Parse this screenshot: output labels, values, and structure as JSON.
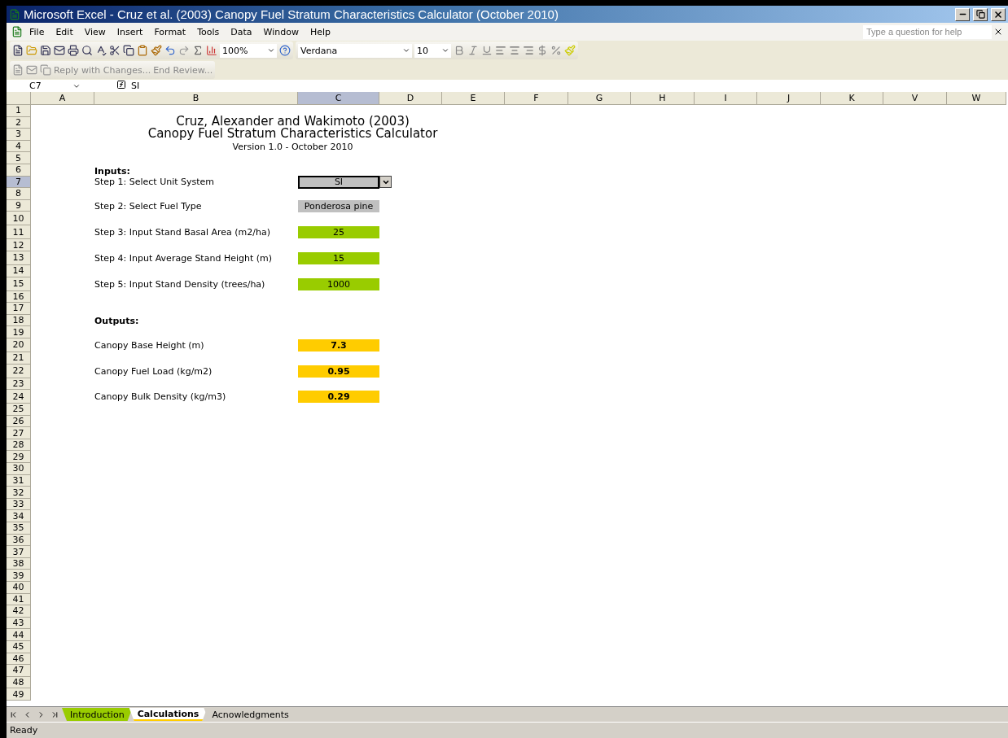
{
  "window": {
    "title": "Microsoft Excel - Cruz et al. (2003) Canopy Fuel Stratum Characteristics Calculator (October 2010)"
  },
  "menu": [
    "File",
    "Edit",
    "View",
    "Insert",
    "Format",
    "Tools",
    "Data",
    "Window",
    "Help"
  ],
  "help_box": {
    "placeholder": "Type a question for help"
  },
  "toolbar": {
    "zoom": "100%",
    "font": "Verdana",
    "font_size": "10"
  },
  "review_toolbar": [
    "Reply with Changes...",
    "End Review..."
  ],
  "formula_bar": {
    "name_box": "C7",
    "formula": "SI"
  },
  "columns": [
    {
      "label": "A",
      "selected": false
    },
    {
      "label": "B",
      "selected": false
    },
    {
      "label": "C",
      "selected": true
    },
    {
      "label": "D",
      "selected": false
    },
    {
      "label": "E",
      "selected": false
    },
    {
      "label": "F",
      "selected": false
    },
    {
      "label": "G",
      "selected": false
    },
    {
      "label": "H",
      "selected": false
    },
    {
      "label": "I",
      "selected": false
    },
    {
      "label": "J",
      "selected": false
    },
    {
      "label": "K",
      "selected": false
    },
    {
      "label": "V",
      "selected": false
    },
    {
      "label": "W",
      "selected": false
    }
  ],
  "rows": [
    {
      "label": "1",
      "selected": false
    },
    {
      "label": "2",
      "selected": false
    },
    {
      "label": "3",
      "selected": false
    },
    {
      "label": "4",
      "selected": false
    },
    {
      "label": "5",
      "selected": false
    },
    {
      "label": "6",
      "selected": false
    },
    {
      "label": "7",
      "selected": true
    },
    {
      "label": "8",
      "selected": false
    },
    {
      "label": "9",
      "selected": false
    },
    {
      "label": "10",
      "selected": false
    },
    {
      "label": "11",
      "selected": false
    },
    {
      "label": "12",
      "selected": false
    },
    {
      "label": "13",
      "selected": false
    },
    {
      "label": "14",
      "selected": false
    },
    {
      "label": "15",
      "selected": false
    },
    {
      "label": "16",
      "selected": false
    },
    {
      "label": "17",
      "selected": false
    },
    {
      "label": "18",
      "selected": false
    },
    {
      "label": "19",
      "selected": false
    },
    {
      "label": "20",
      "selected": false
    },
    {
      "label": "21",
      "selected": false
    },
    {
      "label": "22",
      "selected": false
    },
    {
      "label": "23",
      "selected": false
    },
    {
      "label": "24",
      "selected": false
    },
    {
      "label": "25",
      "selected": false
    },
    {
      "label": "26",
      "selected": false
    },
    {
      "label": "27",
      "selected": false
    },
    {
      "label": "28",
      "selected": false
    },
    {
      "label": "29",
      "selected": false
    },
    {
      "label": "30",
      "selected": false
    },
    {
      "label": "31",
      "selected": false
    },
    {
      "label": "32",
      "selected": false
    },
    {
      "label": "33",
      "selected": false
    },
    {
      "label": "34",
      "selected": false
    },
    {
      "label": "35",
      "selected": false
    },
    {
      "label": "36",
      "selected": false
    },
    {
      "label": "37",
      "selected": false
    },
    {
      "label": "38",
      "selected": false
    },
    {
      "label": "39",
      "selected": false
    },
    {
      "label": "40",
      "selected": false
    },
    {
      "label": "41",
      "selected": false
    },
    {
      "label": "42",
      "selected": false
    },
    {
      "label": "43",
      "selected": false
    },
    {
      "label": "44",
      "selected": false
    },
    {
      "label": "45",
      "selected": false
    },
    {
      "label": "46",
      "selected": false
    },
    {
      "label": "47",
      "selected": false
    },
    {
      "label": "48",
      "selected": false
    },
    {
      "label": "49",
      "selected": false
    }
  ],
  "sheet": {
    "title_lines": [
      "Cruz, Alexander and Wakimoto (2003)",
      "Canopy Fuel Stratum Characteristics Calculator",
      "Version 1.0 - October 2010"
    ],
    "inputs_heading": "Inputs:",
    "inputs": [
      {
        "label": "Step 1: Select Unit System",
        "value": "SI",
        "kind": "dropdown"
      },
      {
        "label": "Step 2: Select Fuel Type",
        "value": "Ponderosa pine",
        "kind": "choice"
      },
      {
        "label": "Step 3: Input Stand Basal Area (m2/ha)",
        "value": "25",
        "kind": "entry"
      },
      {
        "label": "Step 4: Input Average Stand Height (m)",
        "value": "15",
        "kind": "entry"
      },
      {
        "label": "Step 5: Input Stand Density (trees/ha)",
        "value": "1000",
        "kind": "entry"
      }
    ],
    "outputs_heading": "Outputs:",
    "outputs": [
      {
        "label": "Canopy Base Height (m)",
        "value": "7.3"
      },
      {
        "label": "Canopy Fuel Load (kg/m2)",
        "value": "0.95"
      },
      {
        "label": "Canopy Bulk Density (kg/m3)",
        "value": "0.29"
      }
    ]
  },
  "sheet_tabs": [
    {
      "label": "Introduction",
      "selected": false,
      "color": "#99cc00"
    },
    {
      "label": "Calculations",
      "selected": true,
      "color": "#ffcc00"
    },
    {
      "label": "Acnowledgments",
      "selected": false
    }
  ],
  "status_bar": {
    "text": "Ready"
  }
}
